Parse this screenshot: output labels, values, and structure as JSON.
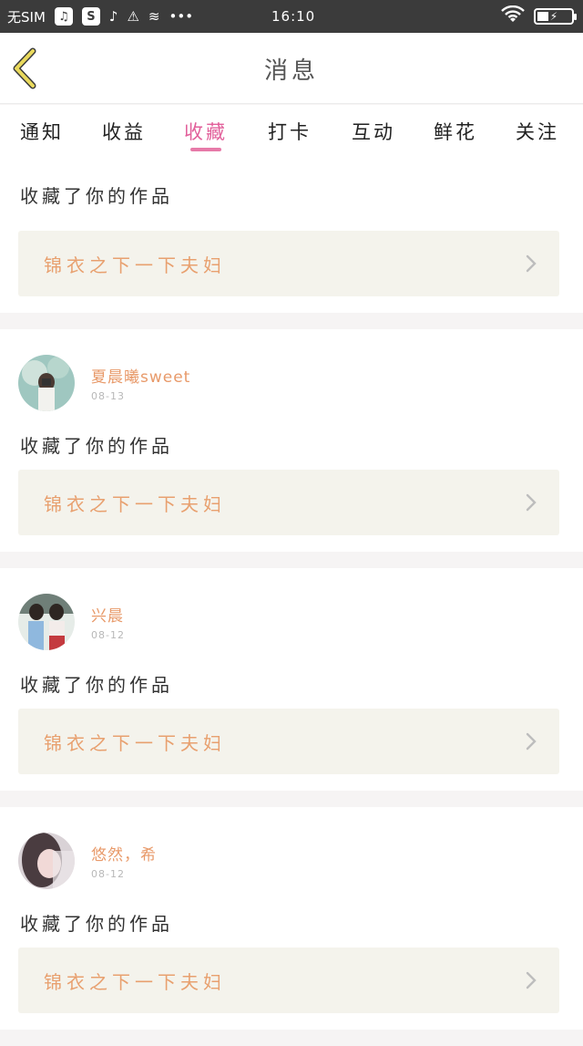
{
  "status_bar": {
    "carrier": "无SIM",
    "time": "16:10",
    "icons": [
      "music-icon",
      "s-icon",
      "sound-icon",
      "warning-icon",
      "database-icon",
      "more-dots-icon",
      "wifi-icon",
      "battery-icon"
    ]
  },
  "header": {
    "title": "消息"
  },
  "tabs": [
    {
      "label": "通知"
    },
    {
      "label": "收益"
    },
    {
      "label": "收藏"
    },
    {
      "label": "打卡"
    },
    {
      "label": "互动"
    },
    {
      "label": "鲜花"
    },
    {
      "label": "关注"
    }
  ],
  "active_tab": "收藏",
  "colors": {
    "accent": "#e2609b",
    "username": "#e89a6a",
    "work_title": "#e8a06f",
    "work_bg": "#f4f3ec",
    "back_arrow": "#e9d95c"
  },
  "items": [
    {
      "action": "收藏了你的作品",
      "work": "锦衣之下一下夫妇"
    },
    {
      "username": "夏晨曦sweet",
      "date": "08-13",
      "action": "收藏了你的作品",
      "work": "锦衣之下一下夫妇"
    },
    {
      "username": "兴晨",
      "date": "08-12",
      "action": "收藏了你的作品",
      "work": "锦衣之下一下夫妇"
    },
    {
      "username": "悠然，希",
      "date": "08-12",
      "action": "收藏了你的作品",
      "work": "锦衣之下一下夫妇"
    }
  ]
}
